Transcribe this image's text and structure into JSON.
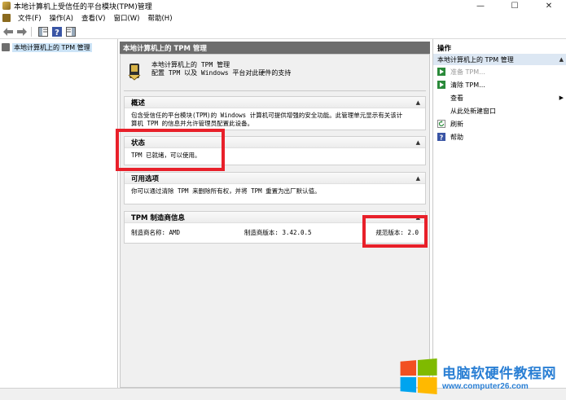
{
  "window": {
    "title": "本地计算机上受信任的平台模块(TPM)管理",
    "controls": [
      "—",
      "☐",
      "✕"
    ]
  },
  "menu": [
    "文件(F)",
    "操作(A)",
    "查看(V)",
    "窗口(W)",
    "帮助(H)"
  ],
  "tree": {
    "root": "本地计算机上的 TPM 管理"
  },
  "center": {
    "header": "本地计算机上的 TPM 管理",
    "intro_line1": "本地计算机上的 TPM 管理",
    "intro_line2": "配置 TPM 以及 Windows 平台对此硬件的支持",
    "overview": {
      "title": "概述",
      "line1": "包含受信任的平台模块(TPM)的 Windows 计算机可提供增强的安全功能。此管理单元显示有关该计",
      "line2": "算机 TPM 的信息并允许管理员配置此设备。"
    },
    "status": {
      "title": "状态",
      "text": "TPM 已就绪，可以使用。"
    },
    "options": {
      "title": "可用选项",
      "text": "你可以通过清除 TPM 来删除所有权，并将 TPM 重置为出厂默认值。"
    },
    "vendor": {
      "title": "TPM 制造商信息",
      "name": "制造商名称: AMD",
      "version": "制造商版本: 3.42.0.5",
      "spec": "规范版本: 2.0"
    }
  },
  "actions": {
    "title": "操作",
    "group": "本地计算机上的 TPM 管理",
    "items": {
      "prepare": "准备 TPM...",
      "clear": "清除 TPM...",
      "view": "查看",
      "new_window": "从此处新建窗口",
      "refresh": "刷新",
      "help": "帮助"
    }
  },
  "watermark": {
    "name": "电脑软硬件教程网",
    "url": "www.computer26.com"
  },
  "colors": {
    "highlight_box": "#e8202a",
    "header_bg": "#6d6d6d",
    "selection": "#cce4f7"
  }
}
